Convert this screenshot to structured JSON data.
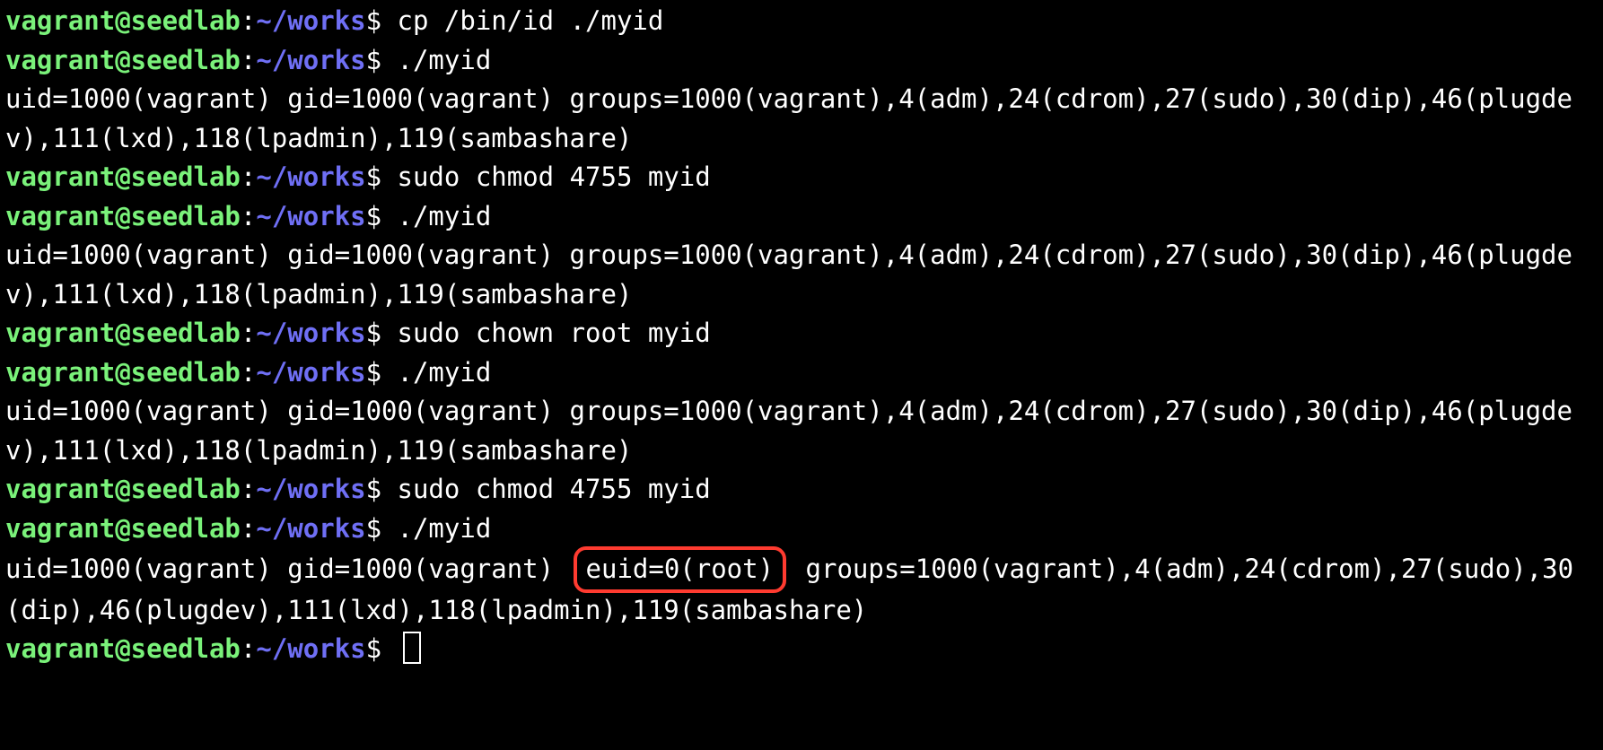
{
  "prompt": {
    "user_host": "vagrant@seedlab",
    "colon": ":",
    "path": "~/works",
    "dollar": "$"
  },
  "lines": [
    {
      "type": "cmd",
      "text": "cp /bin/id ./myid"
    },
    {
      "type": "cmd",
      "text": "./myid"
    },
    {
      "type": "out",
      "text": "uid=1000(vagrant) gid=1000(vagrant) groups=1000(vagrant),4(adm),24(cdrom),27(sudo),30(dip),46(plugdev),111(lxd),118(lpadmin),119(sambashare)"
    },
    {
      "type": "cmd",
      "text": "sudo chmod 4755 myid"
    },
    {
      "type": "cmd",
      "text": "./myid"
    },
    {
      "type": "out",
      "text": "uid=1000(vagrant) gid=1000(vagrant) groups=1000(vagrant),4(adm),24(cdrom),27(sudo),30(dip),46(plugdev),111(lxd),118(lpadmin),119(sambashare)"
    },
    {
      "type": "cmd",
      "text": "sudo chown root myid"
    },
    {
      "type": "cmd",
      "text": "./myid"
    },
    {
      "type": "out",
      "text": "uid=1000(vagrant) gid=1000(vagrant) groups=1000(vagrant),4(adm),24(cdrom),27(sudo),30(dip),46(plugdev),111(lxd),118(lpadmin),119(sambashare)"
    },
    {
      "type": "cmd",
      "text": "sudo chmod 4755 myid"
    },
    {
      "type": "cmd",
      "text": "./myid"
    },
    {
      "type": "out-highlight",
      "pre": "uid=1000(vagrant) gid=1000(vagrant) ",
      "hl": "euid=0(root)",
      "post": " groups=1000(vagrant),4(adm),24(cdrom),27(sudo),30(dip),46(plugdev),111(lxd),118(lpadmin),119(sambashare)"
    },
    {
      "type": "cmd-cursor",
      "text": ""
    }
  ]
}
